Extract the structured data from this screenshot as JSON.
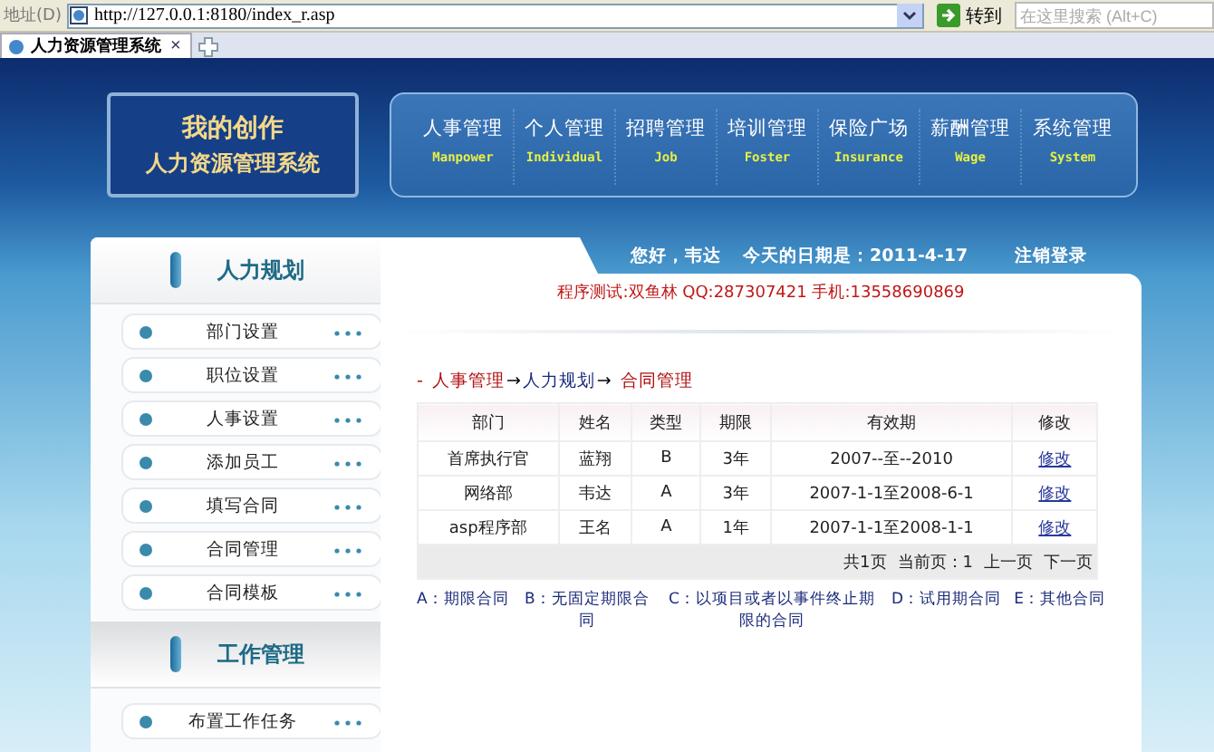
{
  "browser": {
    "address_label": "地址(D)",
    "url": "http://127.0.0.1:8180/index_r.asp",
    "go_button": "转到",
    "search": {
      "placeholder": "在这里搜索 (Alt+C)"
    },
    "tab": {
      "title": "人力资源管理系统",
      "close": "×"
    }
  },
  "logo": {
    "title": "我的创作",
    "subtitle": "人力资源管理系统"
  },
  "nav": [
    {
      "label": "人事管理",
      "en": "Manpower"
    },
    {
      "label": "个人管理",
      "en": "Individual"
    },
    {
      "label": "招聘管理",
      "en": "Job"
    },
    {
      "label": "培训管理",
      "en": "Foster"
    },
    {
      "label": "保险广场",
      "en": "Insurance"
    },
    {
      "label": "薪酬管理",
      "en": "Wage"
    },
    {
      "label": "系统管理",
      "en": "System"
    }
  ],
  "sidebar": [
    {
      "title": "人力规划",
      "items": [
        "部门设置",
        "职位设置",
        "人事设置",
        "添加员工",
        "填写合同",
        "合同管理",
        "合同模板"
      ]
    },
    {
      "title": "工作管理",
      "items": [
        "布置工作任务"
      ]
    }
  ],
  "header": {
    "greeting": "您好，韦达",
    "date": "今天的日期是：2011-4-17",
    "logout": "注销登录"
  },
  "notice": "程序测试:双鱼林 QQ:287307421 手机:13558690869",
  "breadcrumb": {
    "prefix": "-",
    "separator": "→",
    "items": [
      {
        "label": "人事管理",
        "color": "#b01010"
      },
      {
        "label": "人力规划",
        "color": "#1a2a7a"
      },
      {
        "label": "合同管理",
        "color": "#b01010"
      }
    ]
  },
  "table": {
    "columns": [
      "部门",
      "姓名",
      "类型",
      "期限",
      "有效期",
      "修改"
    ],
    "rows": [
      {
        "cells": [
          "首席执行官",
          "蓝翔",
          "B",
          "3年",
          "2007--至--2010"
        ],
        "action": "修改"
      },
      {
        "cells": [
          "网络部",
          "韦达",
          "A",
          "3年",
          "2007-1-1至2008-6-1"
        ],
        "action": "修改"
      },
      {
        "cells": [
          "asp程序部",
          "王名",
          "A",
          "1年",
          "2007-1-1至2008-1-1"
        ],
        "action": "修改"
      }
    ]
  },
  "pager": {
    "total": "共1页",
    "current": "当前页：1",
    "prev": "上一页",
    "next": "下一页"
  },
  "legend": [
    "A：期限合同",
    "B：无固定期限合同",
    "C：以项目或者以事件终止期限的合同",
    "D：试用期合同",
    "E：其他合同"
  ]
}
